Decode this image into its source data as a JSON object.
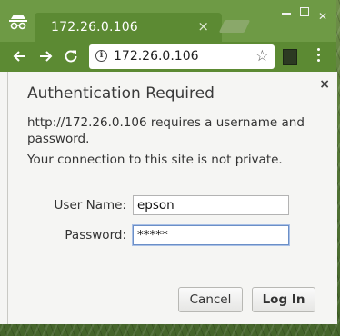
{
  "browser": {
    "tab_title": "172.26.0.106",
    "tab_close": "×",
    "address": "172.26.0.106"
  },
  "dialog": {
    "title": "Authentication Required",
    "message": "http://172.26.0.106 requires a username and password.",
    "warning": "Your connection to this site is not private.",
    "close": "×",
    "username_label": "User Name:",
    "username_value": "epson",
    "password_label": "Password:",
    "password_value": "*****",
    "cancel_label": "Cancel",
    "login_label": "Log In"
  },
  "icons": [
    "incognito-icon",
    "back-icon",
    "forward-icon",
    "reload-icon",
    "info-icon",
    "star-icon",
    "extension-icon",
    "menu-icon",
    "close-icon"
  ],
  "colors": {
    "tab_strip": "#6e9a45",
    "toolbar": "#5c8a33",
    "dialog_bg": "#f5f5f3",
    "focus": "#6b8fc7"
  }
}
